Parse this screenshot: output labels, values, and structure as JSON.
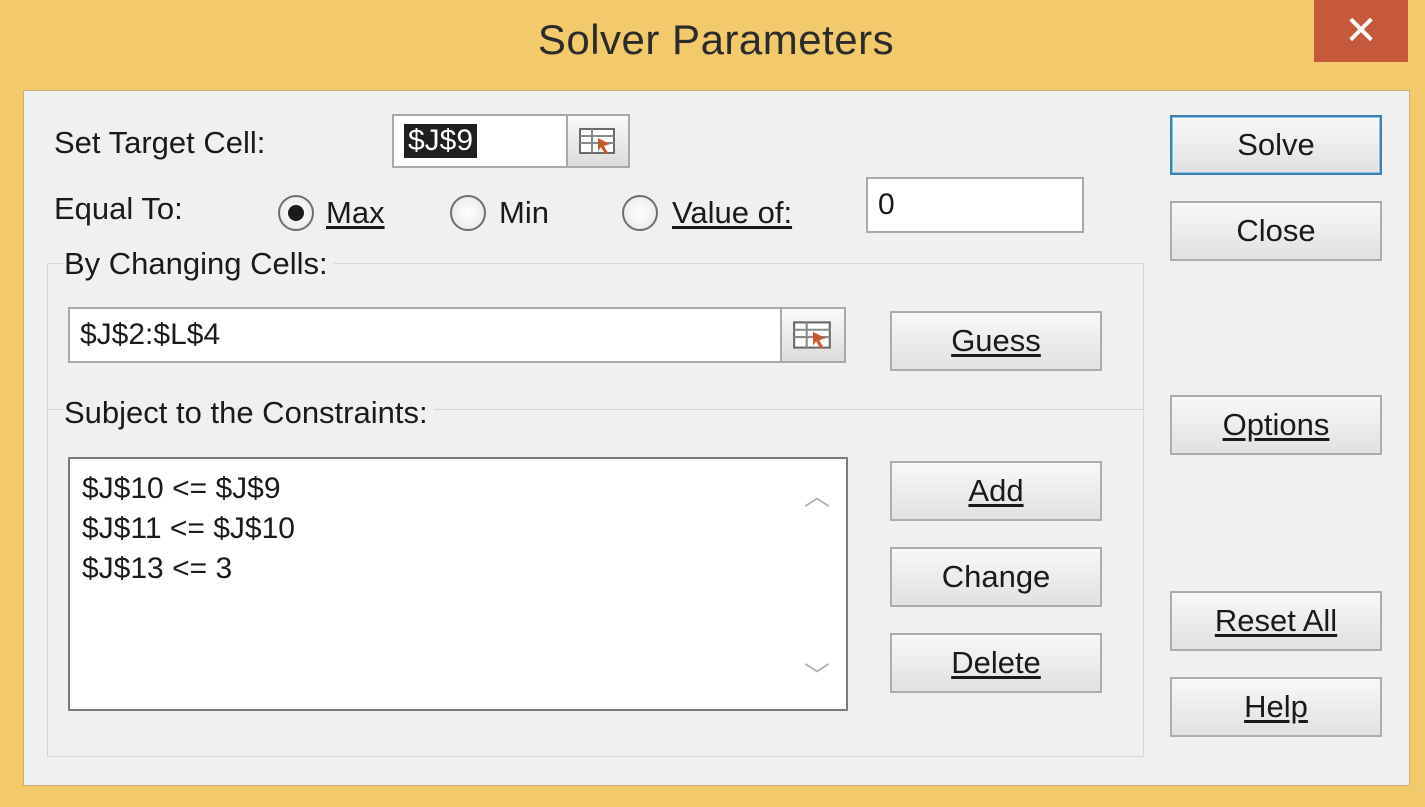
{
  "window": {
    "title": "Solver Parameters",
    "close_glyph": "✕"
  },
  "target": {
    "label": "Set Target Cell:",
    "value": "$J$9"
  },
  "equal_to": {
    "label": "Equal To:",
    "options": [
      {
        "label": "Max",
        "selected": true
      },
      {
        "label": "Min",
        "selected": false
      },
      {
        "label": "Value of:",
        "selected": false
      }
    ],
    "value_of": "0"
  },
  "changing_cells": {
    "label": "By Changing Cells:",
    "value": "$J$2:$L$4"
  },
  "constraints": {
    "label": "Subject to the Constraints:",
    "items": [
      "$J$10 <= $J$9",
      "$J$11 <= $J$10",
      "$J$13 <= 3"
    ]
  },
  "buttons": {
    "guess": "Guess",
    "add": "Add",
    "change": "Change",
    "delete": "Delete",
    "solve": "Solve",
    "close": "Close",
    "options": "Options",
    "reset_all": "Reset All",
    "help": "Help"
  },
  "colors": {
    "title_bar": "#f2c96b",
    "close_button": "#c6593b",
    "client": "#f0f0f0",
    "default_button_border": "#3c7fb1"
  },
  "icons": {
    "range_select": "collapse-dialog-icon",
    "scroll_up": "chevron-up-icon",
    "scroll_down": "chevron-down-icon",
    "close": "close-icon"
  }
}
